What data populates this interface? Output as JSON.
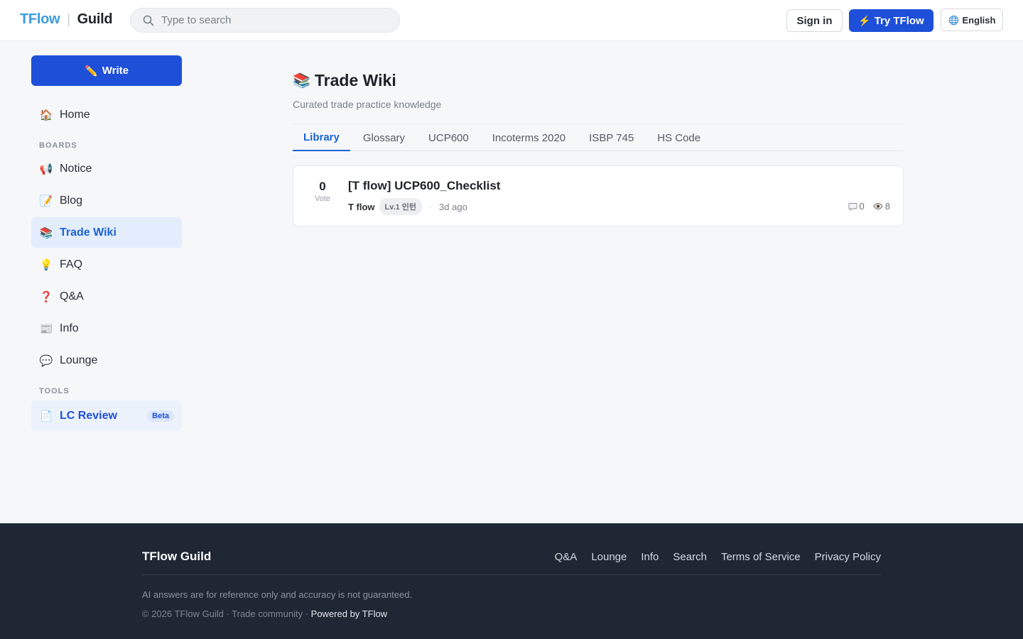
{
  "header": {
    "brand": "TFlow",
    "separator": "|",
    "product": "Guild",
    "search_placeholder": "Type to search",
    "signin_label": "Sign in",
    "try_label": "Try TFlow",
    "language_label": "English"
  },
  "sidebar": {
    "write_label": "Write",
    "home_label": "Home",
    "boards_heading": "BOARDS",
    "boards": [
      {
        "label": "Notice",
        "icon": "📢",
        "icon_name": "megaphone-icon"
      },
      {
        "label": "Blog",
        "icon": "📝",
        "icon_name": "memo-icon"
      },
      {
        "label": "Trade Wiki",
        "icon": "📚",
        "icon_name": "books-icon",
        "active": true
      },
      {
        "label": "FAQ",
        "icon": "💡",
        "icon_name": "lightbulb-icon"
      },
      {
        "label": "Q&A",
        "icon": "❓",
        "icon_name": "question-icon"
      },
      {
        "label": "Info",
        "icon": "📰",
        "icon_name": "newspaper-icon"
      },
      {
        "label": "Lounge",
        "icon": "💬",
        "icon_name": "speech-bubble-icon"
      }
    ],
    "tools_heading": "TOOLS",
    "tools": [
      {
        "label": "LC Review",
        "badge": "Beta",
        "icon": "📄",
        "icon_name": "document-icon"
      }
    ]
  },
  "main": {
    "title": "Trade Wiki",
    "subtitle": "Curated trade practice knowledge",
    "tabs": [
      "Library",
      "Glossary",
      "UCP600",
      "Incoterms 2020",
      "ISBP 745",
      "HS Code"
    ],
    "active_tab": "Library",
    "posts": [
      {
        "votes": "0",
        "vote_label": "Vote",
        "title": "[T flow] UCP600_Checklist",
        "author": "T flow",
        "level": "Lv.1 인턴",
        "time": "3d ago",
        "comments": "0",
        "views": "8"
      }
    ]
  },
  "footer": {
    "brand": "TFlow Guild",
    "links": [
      "Q&A",
      "Lounge",
      "Info",
      "Search",
      "Terms of Service",
      "Privacy Policy"
    ],
    "disclaimer": "AI answers are for reference only and accuracy is not guaranteed.",
    "copyright": "© 2026 TFlow Guild · Trade community · ",
    "powered": "Powered by TFlow"
  },
  "colors": {
    "primary": "#1d4fd8",
    "brand_blue": "#3b9be0",
    "active_text": "#1d63d6",
    "footer_bg": "#1e2733"
  }
}
